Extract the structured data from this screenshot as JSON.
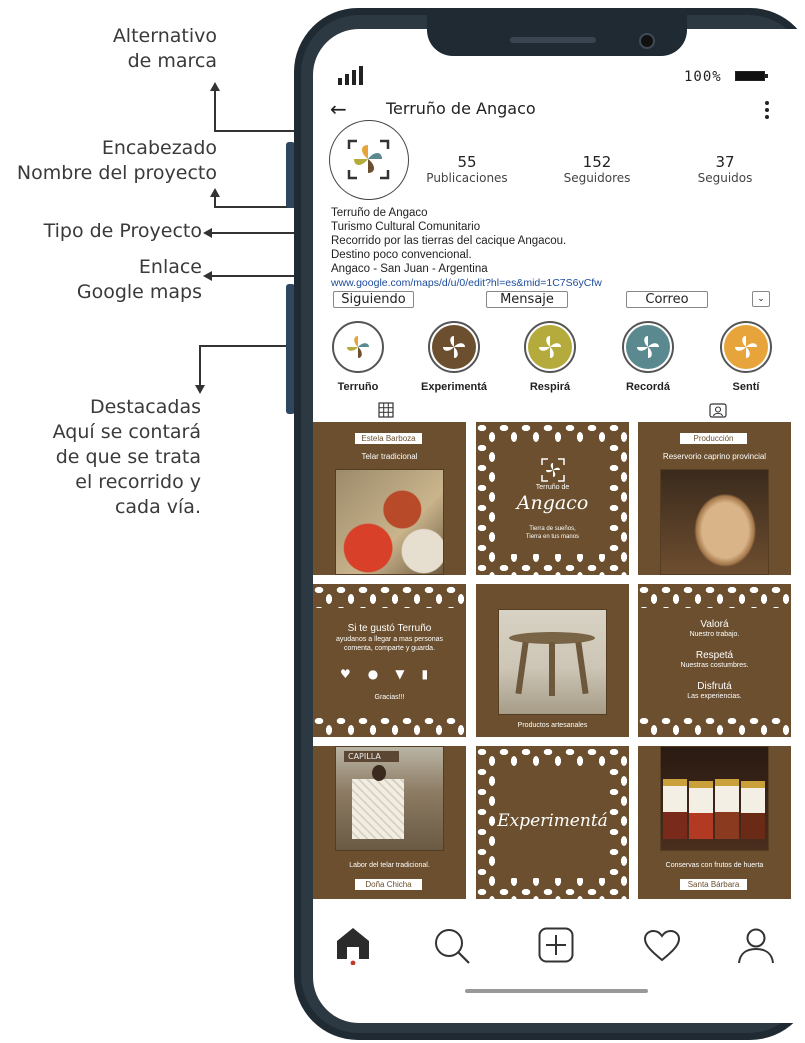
{
  "annotations": {
    "brand": [
      "Alternativo",
      "de marca"
    ],
    "header": [
      "Encabezado",
      "Nombre del proyecto"
    ],
    "type": [
      "Tipo de Proyecto"
    ],
    "link": [
      "Enlace",
      "Google maps"
    ],
    "highlights": [
      "Destacadas",
      "Aquí se contará",
      "de que se trata",
      "el recorrido y",
      "cada vía."
    ]
  },
  "status": {
    "battery": "100%"
  },
  "profile": {
    "name": "Terruño de Angaco",
    "stats": [
      {
        "value": "55",
        "label": "Publicaciones"
      },
      {
        "value": "152",
        "label": "Seguidores"
      },
      {
        "value": "37",
        "label": "Seguidos"
      }
    ],
    "bio": [
      "Terruño de Angaco",
      "Turismo Cultural Comunitario",
      "Recorrido por las tierras del cacique Angacou.",
      "Destino poco convencional.",
      "Angaco - San Juan - Argentina"
    ],
    "link": "www.google.com/maps/d/u/0/edit?hl=es&mid=1C7S6yCfw",
    "buttons": {
      "following": "Siguiendo",
      "message": "Mensaje",
      "email": "Correo"
    }
  },
  "highlights": [
    {
      "label": "Terruño",
      "color": "#ffffff"
    },
    {
      "label": "Experimentá",
      "color": "#6b4f2e"
    },
    {
      "label": "Respirá",
      "color": "#b4ab3c"
    },
    {
      "label": "Recordá",
      "color": "#5a8a90"
    },
    {
      "label": "Sentí",
      "color": "#e6a43a"
    }
  ],
  "posts": {
    "p1": {
      "tag": "Estela Barboza",
      "caption": "Telar tradicional"
    },
    "p2": {
      "brand_small": "Terruño de",
      "brand_big": "Angaco",
      "tag1": "Tierra de sueños,",
      "tag2": "Tierra en tus manos"
    },
    "p3": {
      "tag": "Producción",
      "caption": "Reservorio caprino provincial"
    },
    "p4": {
      "title": "Si te gustó Terruño",
      "line1": "ayudanos a llegar a mas  personas",
      "line2": "comenta, comparte y guarda.",
      "thanks": "Gracias!!!"
    },
    "p5": {
      "caption": "Productos artesanales"
    },
    "p6": {
      "h1": "Valorá",
      "s1": "Nuestro trabajo.",
      "h2": "Respetá",
      "s2": "Nuestras costumbres.",
      "h3": "Disfrutá",
      "s3": "Las experiencias."
    },
    "p7": {
      "caption": "Labor del telar tradicional.",
      "tag": "Doña Chicha",
      "sign": "CAPILLA"
    },
    "p8": {
      "word": "Experimentá"
    },
    "p9": {
      "caption": "Conservas con frutos de huerta",
      "tag": "Santa Bárbara"
    }
  },
  "colors": {
    "brand_brown": "#6b4f2e",
    "olive": "#b4ab3c",
    "teal": "#5a8a90",
    "orange": "#e6a43a",
    "link_blue": "#1b4b9b"
  }
}
